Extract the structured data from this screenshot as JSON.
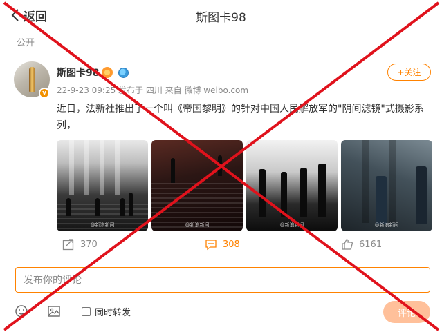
{
  "header": {
    "back_label": "返回",
    "title": "斯图卡98"
  },
  "visibility": "公开",
  "author": {
    "name": "斯图卡98",
    "avatar_badge": "v",
    "meta": "22-9-23 09:25 发布于 四川 来自 微博 weibo.com",
    "follow_label": "+关注"
  },
  "post": {
    "text": "近日，法新社推出了一个叫《帝国黎明》的针对中国人民解放军的\"阴间滤镜\"式摄影系列，",
    "photos": [
      {
        "watermark": "@新浪新闻"
      },
      {
        "watermark": "@新浪新闻"
      },
      {
        "watermark": "@新浪新闻"
      },
      {
        "watermark": "@新浪新闻"
      }
    ]
  },
  "actions": {
    "repost_count": "370",
    "comment_count": "308",
    "like_count": "6161"
  },
  "composer": {
    "placeholder": "发布你的评论",
    "repost_label": "同时转发",
    "submit_label": "评论"
  },
  "colors": {
    "accent": "#ff8200",
    "submit_disabled": "#ffc09a",
    "overlay_cross": "#e0121c"
  },
  "icons": [
    "chevron-left-icon",
    "vip-badge-icon",
    "globe-badge-icon",
    "repost-icon",
    "comment-icon",
    "like-icon",
    "emoji-icon",
    "image-icon"
  ]
}
